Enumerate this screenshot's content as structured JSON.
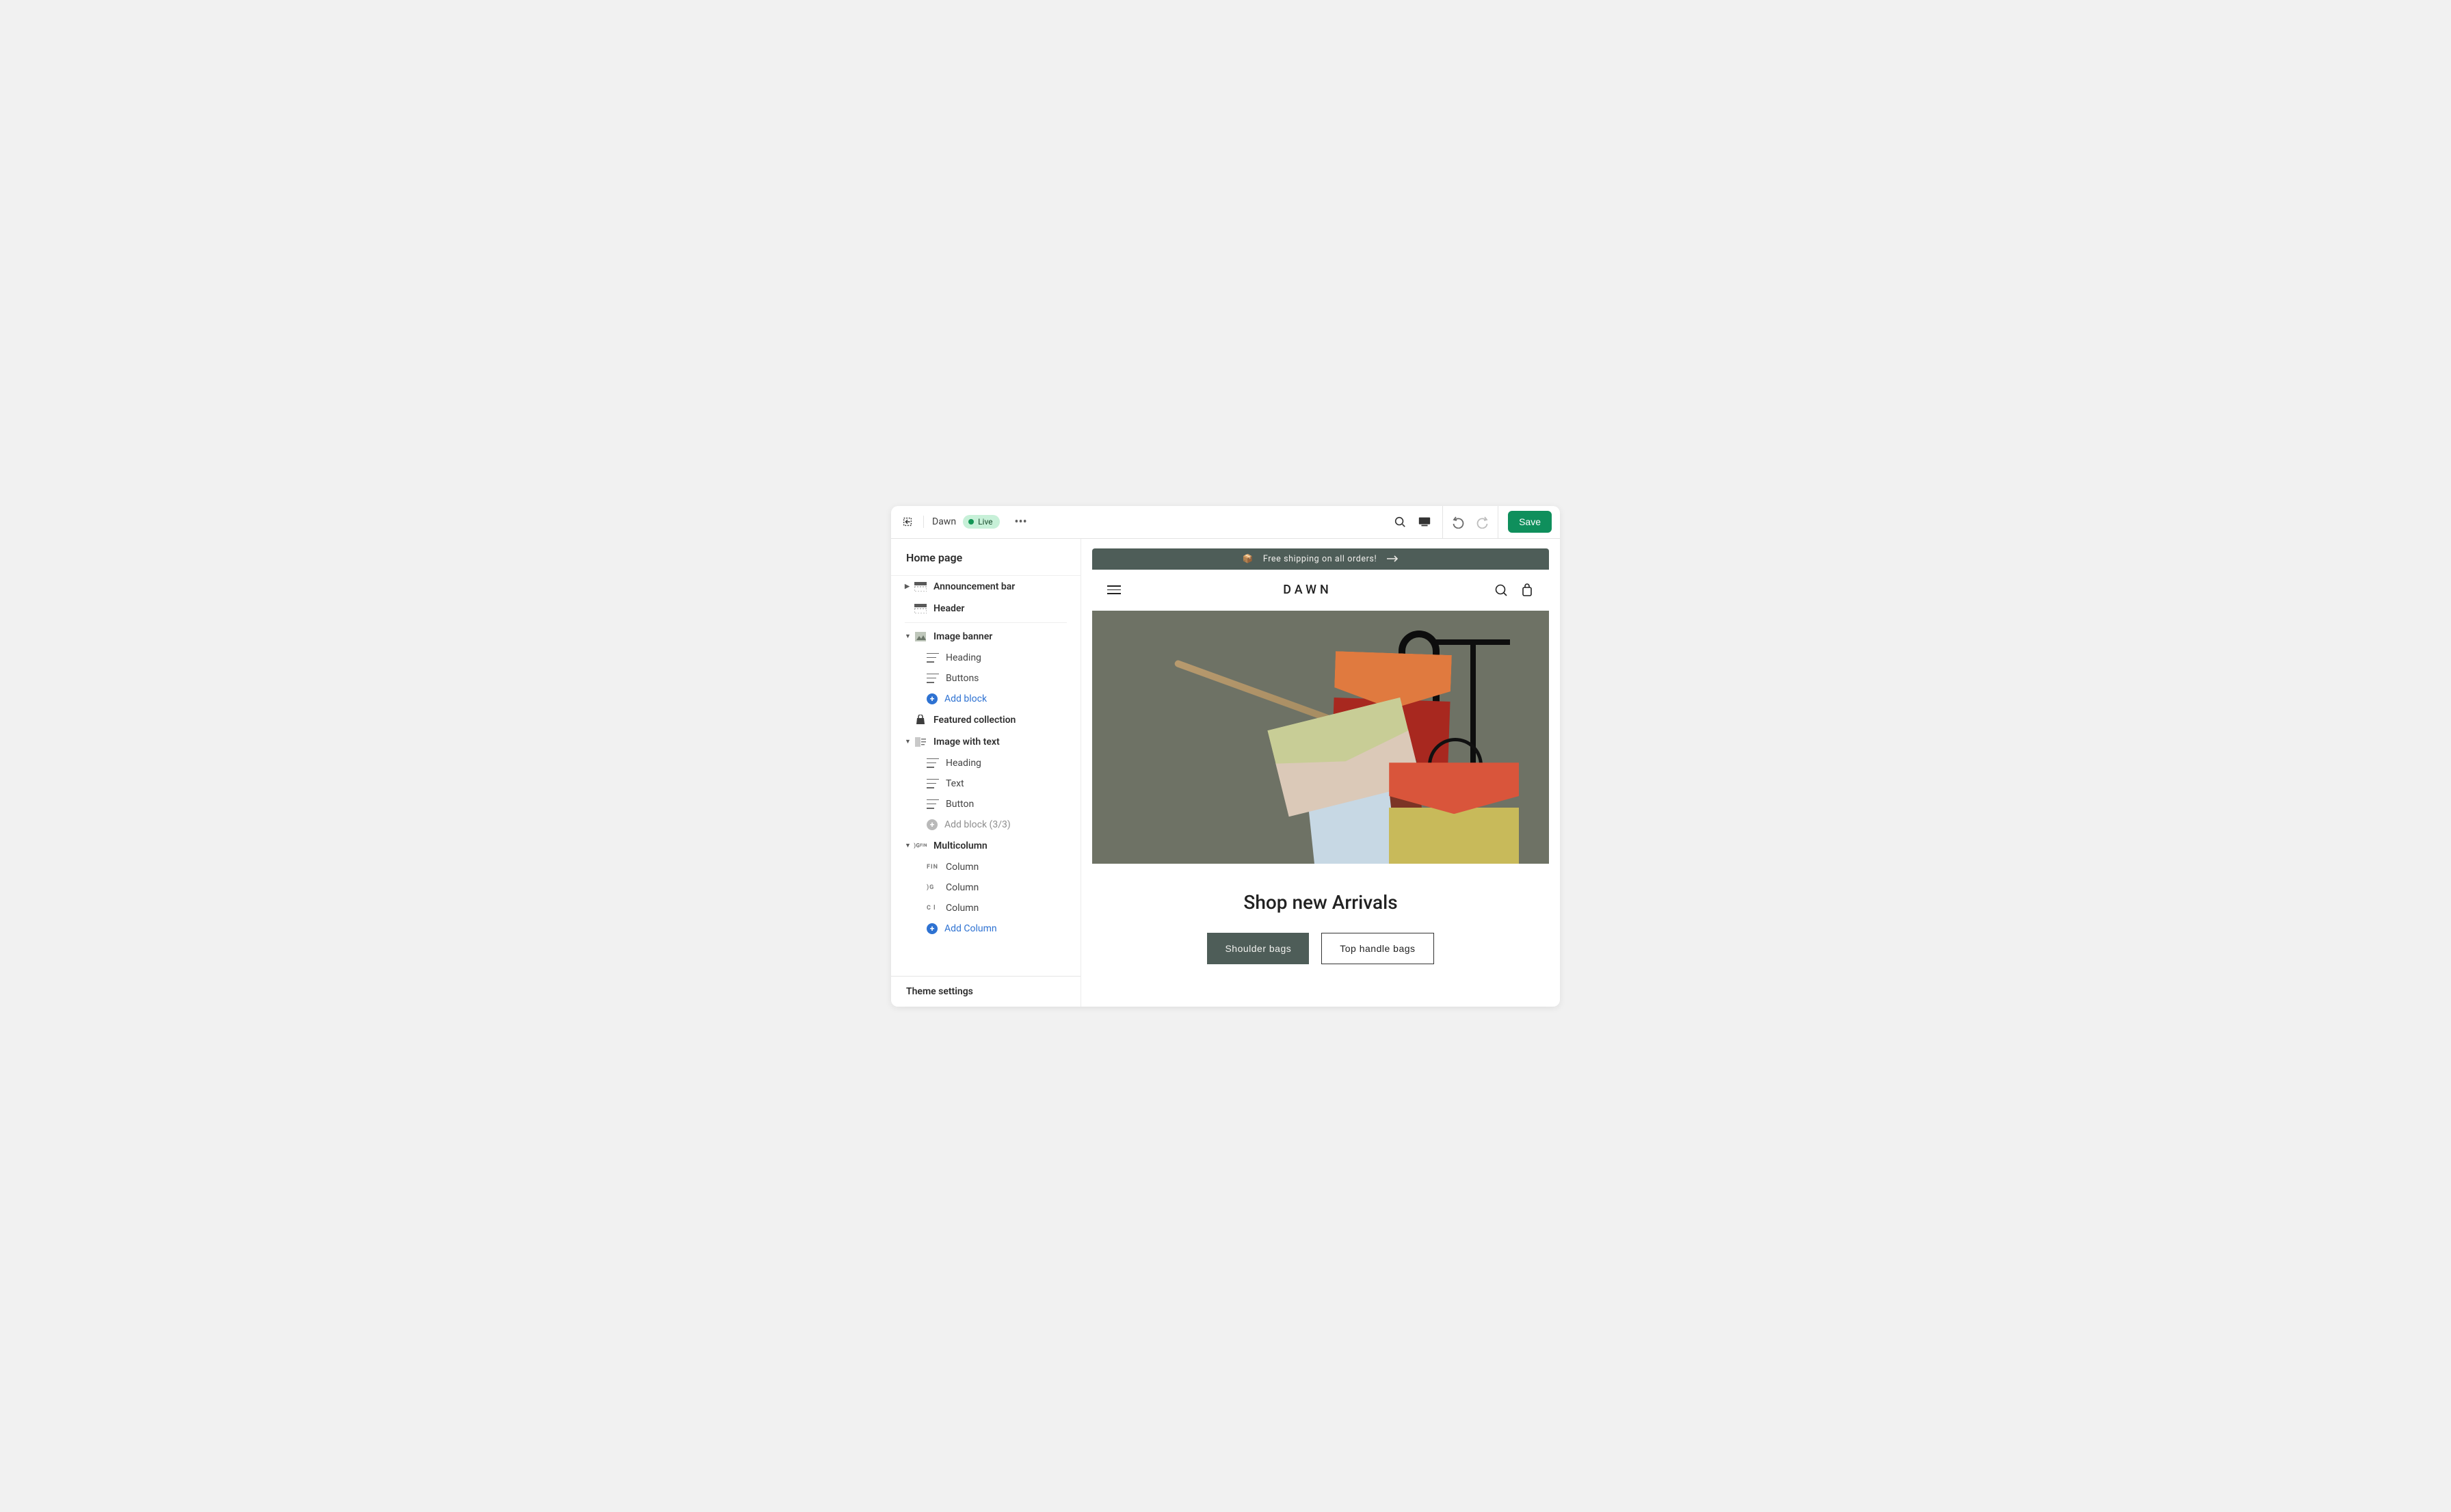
{
  "topbar": {
    "theme_name": "Dawn",
    "status_badge": "Live",
    "save_label": "Save"
  },
  "sidebar": {
    "page_title": "Home page",
    "sections": {
      "announcement": "Announcement bar",
      "header": "Header",
      "image_banner": {
        "label": "Image banner",
        "blocks": {
          "heading": "Heading",
          "buttons": "Buttons"
        },
        "add": "Add block"
      },
      "featured_collection": "Featured collection",
      "image_with_text": {
        "label": "Image with text",
        "blocks": {
          "heading": "Heading",
          "text": "Text",
          "button": "Button"
        },
        "add": "Add block (3/3)"
      },
      "multicolumn": {
        "label": "Multicolumn",
        "columns": {
          "c1": "Column",
          "c2": "Column",
          "c3": "Column"
        },
        "add": "Add Column"
      }
    },
    "theme_settings": "Theme settings"
  },
  "preview": {
    "announcement": "Free shipping on all orders!",
    "brand": "DAWN",
    "hero_heading": "Shop new Arrivals",
    "cta_primary": "Shoulder bags",
    "cta_secondary": "Top handle bags"
  }
}
